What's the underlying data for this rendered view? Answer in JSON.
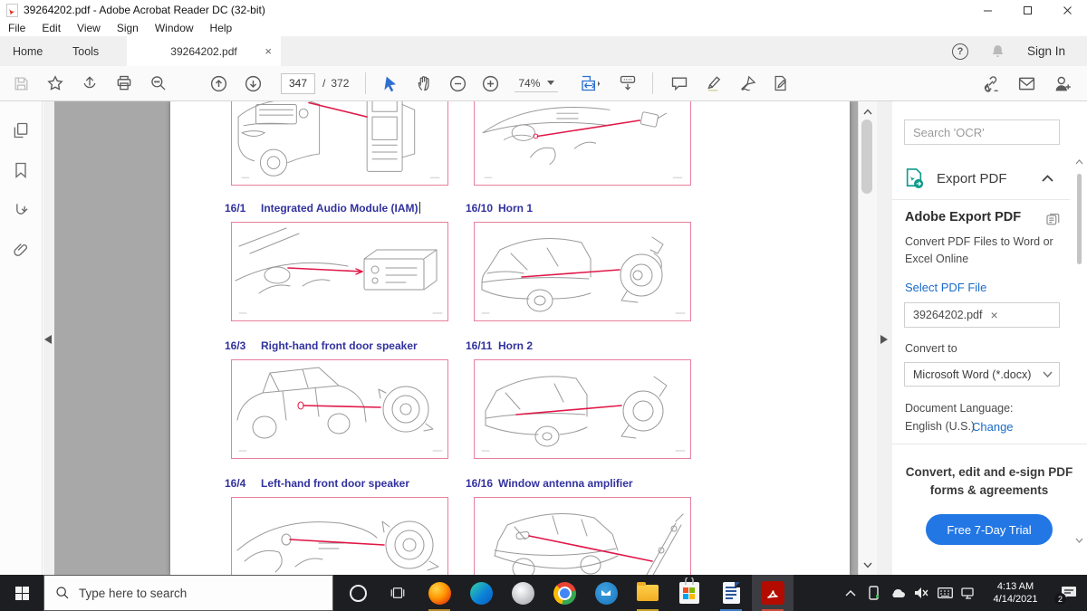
{
  "window": {
    "title": "39264202.pdf - Adobe Acrobat Reader DC (32-bit)",
    "menu": [
      "File",
      "Edit",
      "View",
      "Sign",
      "Window",
      "Help"
    ]
  },
  "tabbar": {
    "home": "Home",
    "tools": "Tools",
    "document_tab": "39264202.pdf",
    "close_icon": "×",
    "sign_in": "Sign In",
    "help_icon": "?"
  },
  "toolbar": {
    "page_current": "347",
    "page_divider": "/",
    "page_total": "372",
    "zoom_value": "74%"
  },
  "page": {
    "captions": [
      {
        "num": "16/1",
        "label": "Integrated Audio Module (IAM)"
      },
      {
        "num": "16/10",
        "label": "Horn 1"
      },
      {
        "num": "16/3",
        "label": "Right-hand front door speaker"
      },
      {
        "num": "16/11",
        "label": "Horn 2"
      },
      {
        "num": "16/4",
        "label": "Left-hand front door speaker"
      },
      {
        "num": "16/16",
        "label": "Window antenna amplifier"
      }
    ]
  },
  "export_panel": {
    "search_placeholder": "Search 'OCR'",
    "section_title": "Export PDF",
    "heading": "Adobe Export PDF",
    "description": "Convert PDF Files to Word or Excel Online",
    "select_file_link": "Select PDF File",
    "file_name": "39264202.pdf",
    "file_clear_icon": "×",
    "convert_to_label": "Convert to",
    "format_value": "Microsoft Word (*.docx)",
    "language_label": "Document Language:",
    "language_value": "English (U.S.)",
    "change_link": "Change",
    "promo_text": "Convert, edit and e-sign PDF forms & agreements",
    "trial_button": "Free 7-Day Trial"
  },
  "taskbar": {
    "search_placeholder": "Type here to search",
    "clock_time": "4:13 AM",
    "clock_date": "4/14/2021",
    "notification_badge": "2"
  },
  "colors": {
    "caption_blue": "#32329f",
    "figure_border_pink": "#e87f9d",
    "callout_red": "#e01747",
    "link_blue": "#1a6bc8",
    "trial_button_blue": "#2377e4",
    "export_teal": "#0e9c8d",
    "acrobat_red": "#b30b00",
    "document_background_gray": "#a8a8a8"
  }
}
